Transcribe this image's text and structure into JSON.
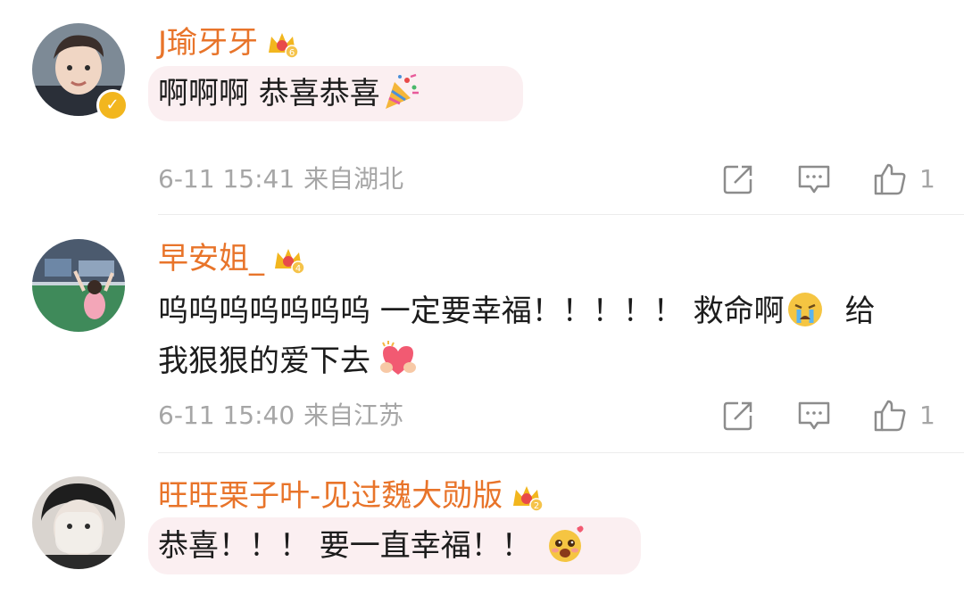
{
  "comments": [
    {
      "username": "J瑜牙牙",
      "text": "啊啊啊 恭喜恭喜",
      "time": "6-11 15:41",
      "location": "来自湖北",
      "likes": "1",
      "crown_level": "6",
      "emoji": "party-popper-icon"
    },
    {
      "username": "早安姐_",
      "text_line1": "呜呜呜呜呜呜呜  一定要幸福！！！！！ 救命啊",
      "text_line1_tail": "给",
      "text_line2": "我狠狠的爱下去",
      "time": "6-11 15:40",
      "location": "来自江苏",
      "likes": "1",
      "crown_level": "4"
    },
    {
      "username": "旺旺栗子叶-见过魏大勋版",
      "text": "恭喜！！！ 要一直幸福！！",
      "crown_level": "2"
    }
  ],
  "colors": {
    "username": "#e8742a",
    "meta": "#a6a6a6",
    "bubble": "#fbeff1",
    "verified": "#f2b61e"
  }
}
